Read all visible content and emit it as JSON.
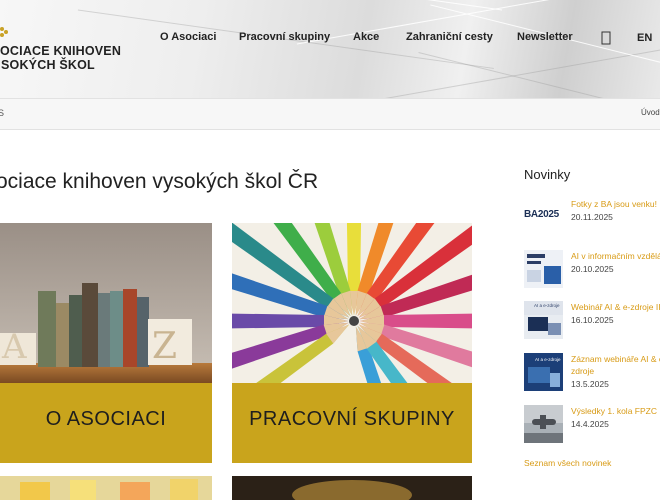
{
  "header": {
    "logo_line1": "OCIACE KNIHOVEN",
    "logo_line2": "SOKÝCH ŠKOL",
    "nav": [
      {
        "label": "O Asociaci"
      },
      {
        "label": "Pracovní skupiny"
      },
      {
        "label": "Akce"
      },
      {
        "label": "Zahraniční cesty"
      },
      {
        "label": "Newsletter"
      }
    ],
    "search_icon": "search-icon",
    "lang": "EN",
    "accent": "#c9a227"
  },
  "breadcrumb": {
    "left": "S",
    "right": "Úvodní"
  },
  "main": {
    "title": "ociace knihoven vysokých škol ČR",
    "tiles": [
      {
        "label": "O ASOCIACI",
        "image": "books-between-bookends"
      },
      {
        "label": "PRACOVNÍ SKUPINY",
        "image": "colored-pencils-circle"
      }
    ],
    "band_color": "#c9a41c"
  },
  "sidebar": {
    "title": "Novinky",
    "news": [
      {
        "title": "Fotky z BA jsou venku!",
        "date": "20.11.2025",
        "thumb_text": "BA2025"
      },
      {
        "title": "AI v informačním vzdělávání",
        "date": "20.10.2025"
      },
      {
        "title": "Webinář AI & e-zdroje III",
        "date": "16.10.2025",
        "thumb_text": "AI a e-zdroje"
      },
      {
        "title": "Záznam webináře AI & e-",
        "title2": "zdroje",
        "date": "13.5.2025",
        "thumb_text": "AI a e-zdroje"
      },
      {
        "title": "Výsledky 1. kola FPZC",
        "date": "14.4.2025"
      }
    ],
    "all_link": "Seznam všech novinek",
    "link_color": "#d89b16"
  }
}
